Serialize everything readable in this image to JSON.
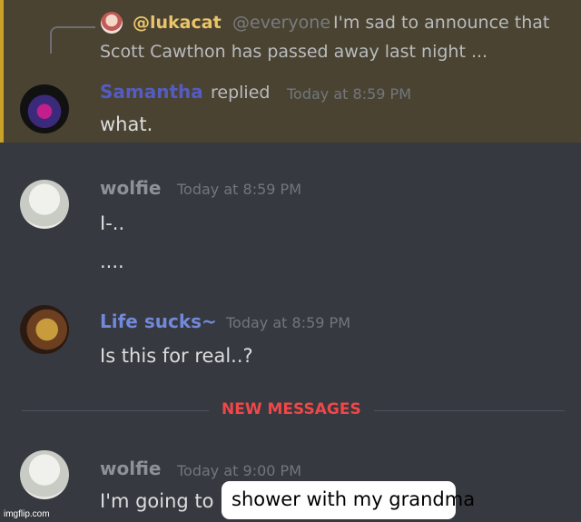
{
  "reply": {
    "user": "@lukacat",
    "mention": "@everyone",
    "text_line1": "I'm sad to announce that",
    "text_line2": "Scott Cawthon has passed away last night ..."
  },
  "messages": [
    {
      "user": "Samantha",
      "replied_label": "replied",
      "timestamp": "Today at 8:59 PM",
      "lines": [
        "what."
      ]
    },
    {
      "user": "wolfie",
      "timestamp": "Today at 8:59 PM",
      "lines": [
        "I-..",
        "...."
      ]
    },
    {
      "user": "Life sucks~",
      "timestamp": "Today at 8:59 PM",
      "lines": [
        "Is this for real..?"
      ]
    },
    {
      "user": "wolfie",
      "timestamp": "Today at 9:00 PM",
      "lines": [
        "I'm going to"
      ]
    }
  ],
  "divider": {
    "label": "NEW MESSAGES"
  },
  "overlay": {
    "text": "shower with my grandma"
  },
  "watermark": "imgflip.com",
  "colors": {
    "highlight_bg": "#4a4332",
    "accent_gold": "#e9c46a",
    "new_messages_red": "#f04747",
    "background": "#36393f"
  }
}
